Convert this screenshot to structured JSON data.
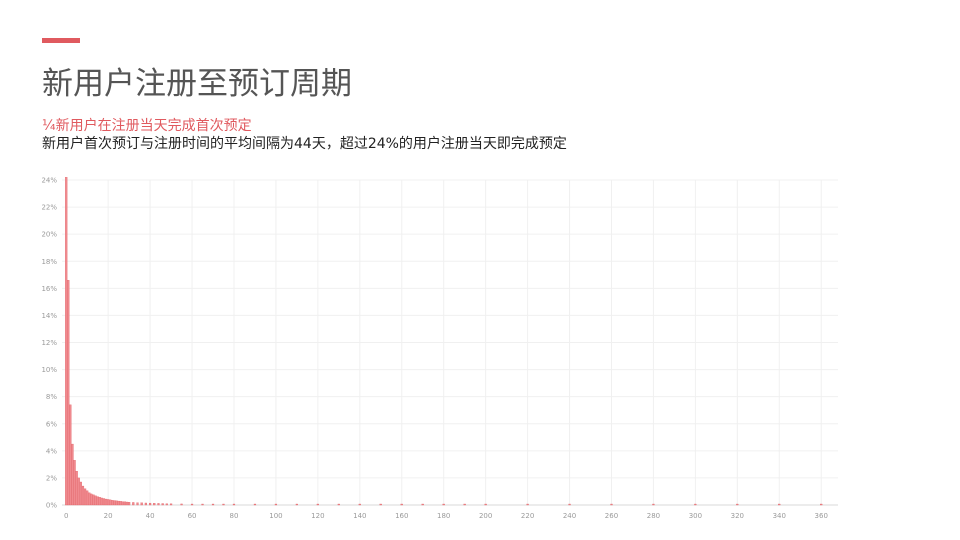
{
  "slide": {
    "title": "新用户注册至预订周期",
    "subtitle": "¼新用户在注册当天完成首次预定",
    "description": "新用户首次预订与注册时间的平均间隔为44天，超过24%的用户注册当天即完成预定"
  },
  "colors": {
    "accent": "#e05a5f",
    "bar_fill": "#f08a8f",
    "bar_stroke": "#e05a5f",
    "title_text": "#555555",
    "grid": "#f0f0f0"
  },
  "chart_data": {
    "type": "bar",
    "title": "",
    "xlabel": "",
    "ylabel": "",
    "xlim": [
      -2,
      368
    ],
    "ylim": [
      0,
      24
    ],
    "x_ticks": [
      0,
      20,
      40,
      60,
      80,
      100,
      120,
      140,
      160,
      180,
      200,
      220,
      240,
      260,
      280,
      300,
      320,
      340,
      360
    ],
    "y_ticks": [
      0,
      2,
      4,
      6,
      8,
      10,
      12,
      14,
      16,
      18,
      20,
      22,
      24
    ],
    "y_tick_labels": [
      "0%",
      "2%",
      "4%",
      "6%",
      "8%",
      "10%",
      "12%",
      "14%",
      "16%",
      "18%",
      "20%",
      "22%",
      "24%"
    ],
    "x": [
      0,
      1,
      2,
      3,
      4,
      5,
      6,
      7,
      8,
      9,
      10,
      11,
      12,
      13,
      14,
      15,
      16,
      17,
      18,
      19,
      20,
      21,
      22,
      23,
      24,
      25,
      26,
      27,
      28,
      29,
      30,
      32,
      34,
      36,
      38,
      40,
      42,
      44,
      46,
      48,
      50,
      55,
      60,
      65,
      70,
      75,
      80,
      90,
      100,
      110,
      120,
      130,
      140,
      150,
      160,
      170,
      180,
      190,
      200,
      220,
      240,
      260,
      280,
      300,
      320,
      340,
      360
    ],
    "values": [
      24.2,
      16.6,
      7.4,
      4.5,
      3.3,
      2.5,
      2.0,
      1.7,
      1.4,
      1.2,
      1.05,
      0.9,
      0.82,
      0.75,
      0.68,
      0.62,
      0.57,
      0.52,
      0.48,
      0.44,
      0.41,
      0.38,
      0.35,
      0.33,
      0.31,
      0.29,
      0.27,
      0.25,
      0.24,
      0.22,
      0.21,
      0.19,
      0.17,
      0.16,
      0.15,
      0.14,
      0.13,
      0.12,
      0.11,
      0.1,
      0.09,
      0.08,
      0.07,
      0.065,
      0.06,
      0.055,
      0.05,
      0.045,
      0.04,
      0.035,
      0.03,
      0.03,
      0.028,
      0.026,
      0.025,
      0.024,
      0.023,
      0.022,
      0.021,
      0.02,
      0.02,
      0.019,
      0.018,
      0.018,
      0.017,
      0.017,
      0.016
    ],
    "grid": true,
    "legend": "none"
  }
}
